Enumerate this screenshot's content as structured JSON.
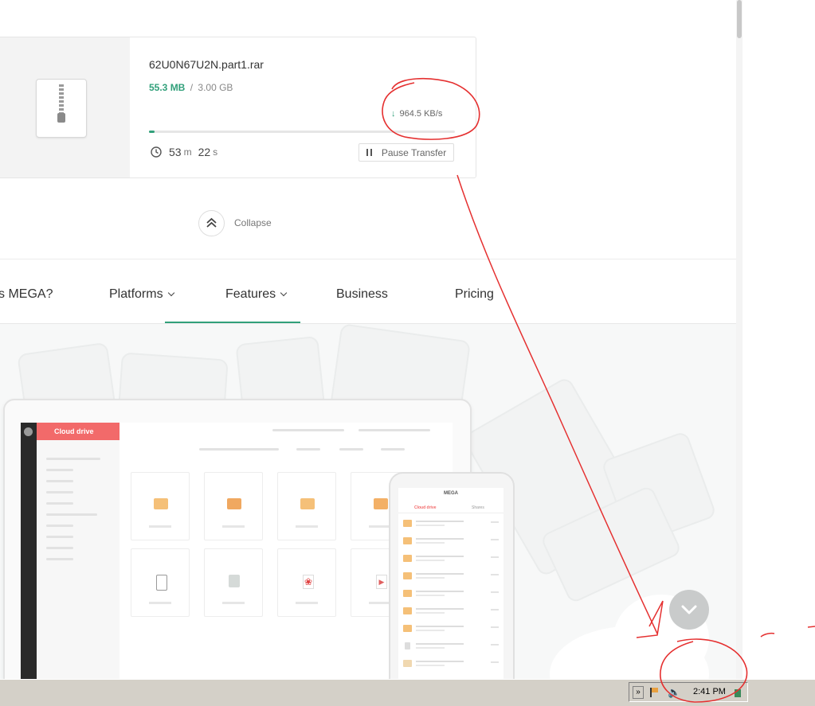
{
  "transfer": {
    "file_name": "62U0N67U2N.part1.rar",
    "size_done": "55.3 MB",
    "size_separator": "/",
    "size_total": "3.00 GB",
    "speed": "964.5 KB/s",
    "progress_fraction": 0.018,
    "time_minutes": "53",
    "time_minutes_unit": "m",
    "time_seconds": "22",
    "time_seconds_unit": "s",
    "pause_label": "Pause Transfer"
  },
  "collapse_label": "Collapse",
  "nav": {
    "items": [
      {
        "label": "s MEGA?"
      },
      {
        "label": "Platforms",
        "dropdown": true
      },
      {
        "label": "Features",
        "dropdown": true,
        "active": true
      },
      {
        "label": "Business"
      },
      {
        "label": "Pricing"
      }
    ]
  },
  "hero": {
    "laptop_tab": "Cloud drive",
    "phone_title": "MEGA",
    "phone_tab_cloud": "Cloud drive",
    "phone_tab_shares": "Shares"
  },
  "taskbar": {
    "clock": "2:41 PM",
    "expand_glyph": "»"
  },
  "colors": {
    "accent": "#31a07a",
    "mega_red": "#f26a6a",
    "annotation": "#e53030"
  }
}
